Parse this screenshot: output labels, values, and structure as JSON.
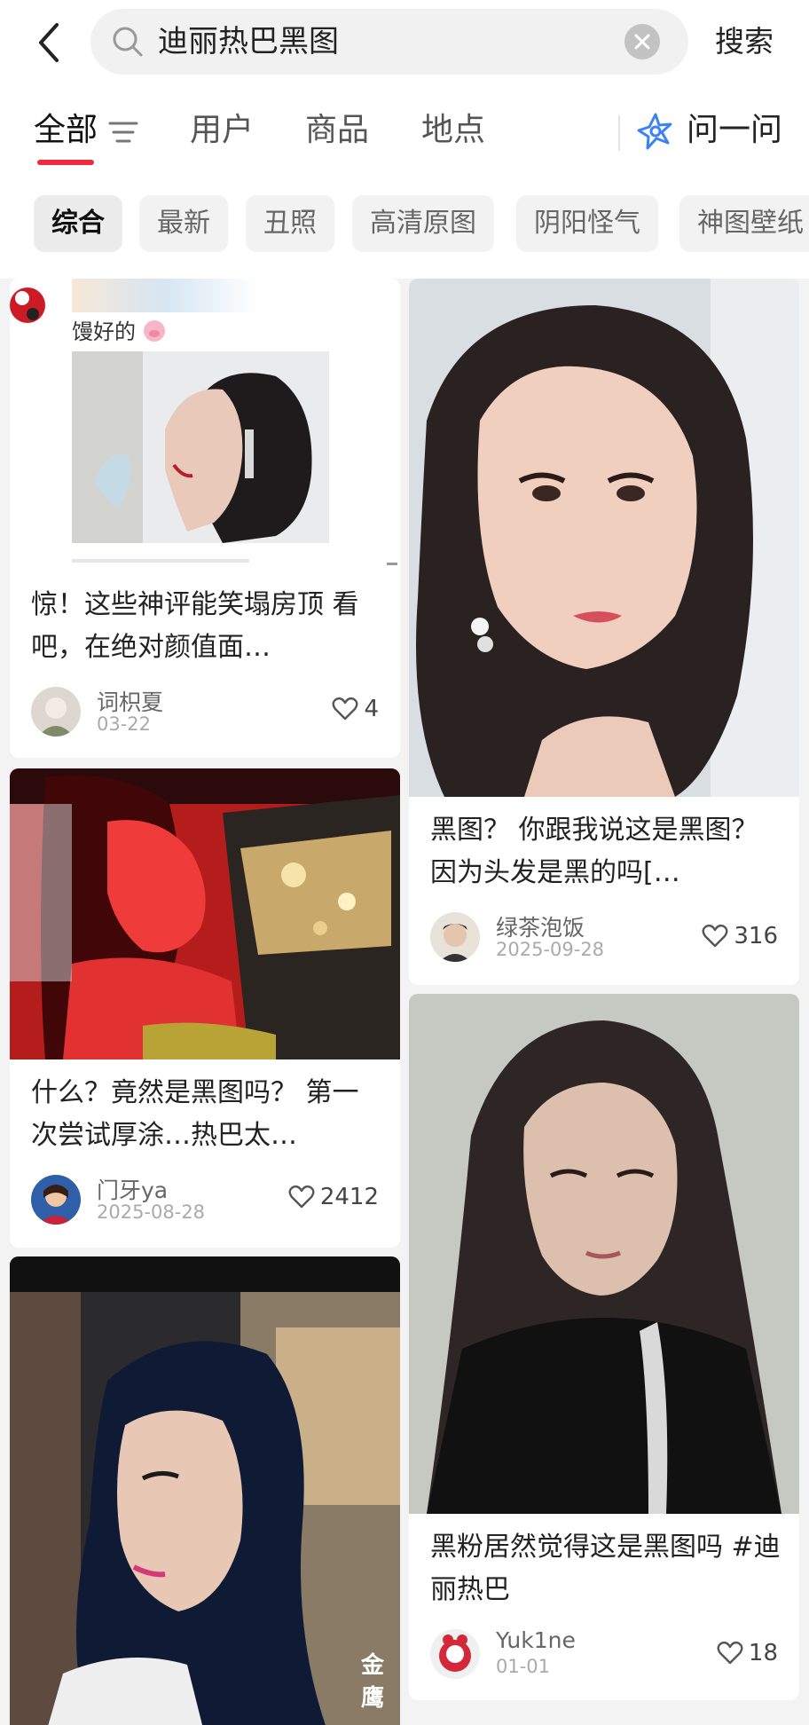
{
  "search": {
    "query": "迪丽热巴黑图",
    "submit_label": "搜索"
  },
  "tabs": [
    {
      "label": "全部",
      "active": true
    },
    {
      "label": "用户"
    },
    {
      "label": "商品"
    },
    {
      "label": "地点"
    }
  ],
  "ask": {
    "label": "问一问"
  },
  "chips": [
    {
      "label": "综合",
      "active": true
    },
    {
      "label": "最新"
    },
    {
      "label": "丑照"
    },
    {
      "label": "高清原图"
    },
    {
      "label": "阴阳怪气"
    },
    {
      "label": "神图壁纸"
    }
  ],
  "cards": [
    {
      "caption": "馒好的",
      "title": "惊！这些神评能笑塌房顶 看吧，在绝对颜值面…",
      "author": "词枳夏",
      "date": "03-22",
      "likes": "4"
    },
    {
      "title": "黑图？ 你跟我说这是黑图？因为头发是黑的吗[…",
      "author": "绿茶泡饭",
      "date": "2025-09-28",
      "likes": "316"
    },
    {
      "title": "什么？竟然是黑图吗？ 第一次尝试厚涂…热巴太…",
      "author": "门牙ya",
      "date": "2025-08-28",
      "likes": "2412"
    },
    {
      "title": "黑粉居然觉得这是黑图吗 #迪丽热巴",
      "author": "Yuk1ne",
      "date": "01-01",
      "likes": "18"
    },
    {
      "watermark": "金鹰"
    }
  ],
  "colors": {
    "accent": "#ee2a3c",
    "ask_icon": "#3b82f6",
    "page_bg": "#f3f3f3"
  },
  "icons": [
    "back-icon",
    "search-icon",
    "clear-icon",
    "filter-icon",
    "ask-icon",
    "heart-icon"
  ]
}
